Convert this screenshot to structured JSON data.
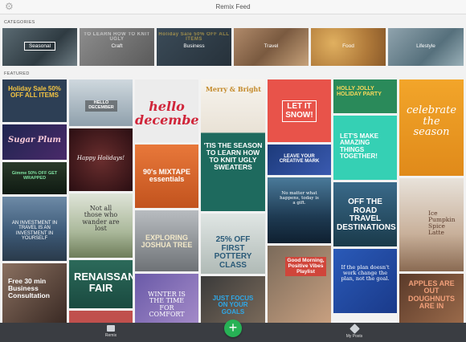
{
  "header": {
    "title": "Remix Feed"
  },
  "sections": {
    "categories": "CATEGORIES",
    "featured": "FEATURED"
  },
  "categories": [
    {
      "label": "Seasonal",
      "overlay": ""
    },
    {
      "label": "Craft",
      "overlay": "TO LEARN HOW TO KNIT UGLY"
    },
    {
      "label": "Business",
      "overlay": "Holiday Sale 50% OFF ALL ITEMS"
    },
    {
      "label": "Travel",
      "overlay": ""
    },
    {
      "label": "Food",
      "overlay": ""
    },
    {
      "label": "Lifestyle",
      "overlay": ""
    }
  ],
  "tiles": [
    {
      "text": "Holiday Sale 50% OFF ALL ITEMS"
    },
    {
      "text": "Sugar Plum"
    },
    {
      "text": "Gimme 50% OFF GET WRAPPED"
    },
    {
      "text": "AN INVESTMENT IN TRAVEL IS AN INVESTMENT IN YOURSELF"
    },
    {
      "text": "Free 30 min Business Consultation"
    },
    {
      "text": "HELLO DECEMBER"
    },
    {
      "text": "Happy Holidays!"
    },
    {
      "text": "Not all those who wander are lost"
    },
    {
      "text": "RENAISSANCE FAIR"
    },
    {
      "text": "hello december"
    },
    {
      "text": "90's MIXTAPE essentials"
    },
    {
      "text": "EXPLORING JOSHUA TREE"
    },
    {
      "text": "WINTER IS THE TIME FOR COMFORT"
    },
    {
      "text": "Merry & Bright"
    },
    {
      "text": "'TIS THE SEASON TO LEARN HOW TO KNIT UGLY SWEATERS"
    },
    {
      "text": "25% OFF FIRST POTTERY CLASS"
    },
    {
      "text": "JUST FOCUS ON YOUR GOALS"
    },
    {
      "text": "LET IT SNOW!"
    },
    {
      "text": "LEAVE YOUR CREATIVE MARK"
    },
    {
      "text": "No matter what happens, today is a gift."
    },
    {
      "text": "Good Morning, Positive Vibes Playlist"
    },
    {
      "text": "HOLLY JOLLY HOLIDAY PARTY"
    },
    {
      "text": "LET'S MAKE AMAZING THINGS TOGETHER!"
    },
    {
      "text": "OFF THE ROAD TRAVEL DESTINATIONS"
    },
    {
      "text": "If the plan doesn't work change the plan, not the goal."
    },
    {
      "text": "celebrate the season"
    },
    {
      "text": "Ice Pumpkin Spice Latte"
    },
    {
      "text": "APPLES ARE OUT DOUGHNUTS ARE IN"
    }
  ],
  "bottom": {
    "remix": "Remix",
    "myposts": "My Posts",
    "fab": "+"
  }
}
